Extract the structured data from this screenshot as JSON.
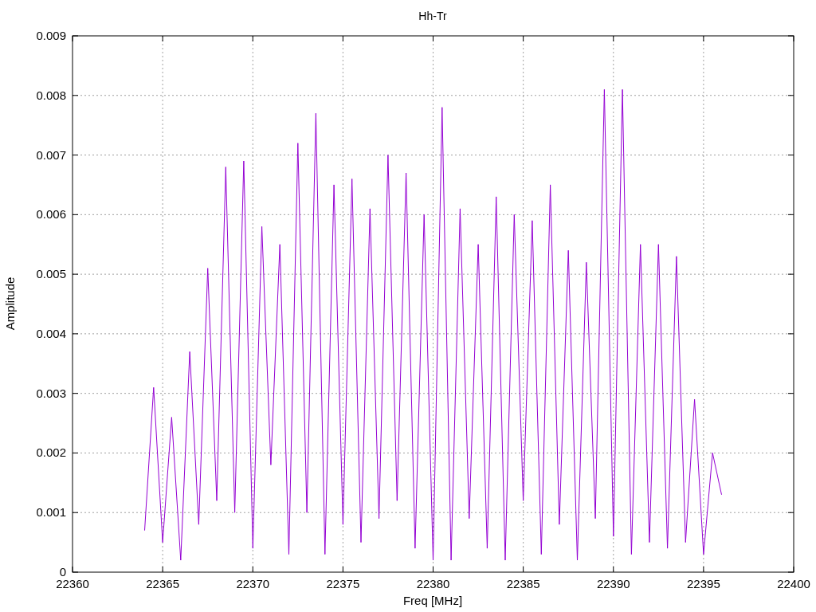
{
  "chart_data": {
    "type": "line",
    "title": "Hh-Tr",
    "xlabel": "Freq [MHz]",
    "ylabel": "Amplitude",
    "grid": true,
    "xlim": [
      22360,
      22400
    ],
    "ylim": [
      0,
      0.009
    ],
    "xticks": [
      22360,
      22365,
      22370,
      22375,
      22380,
      22385,
      22390,
      22395,
      22400
    ],
    "yticks": [
      {
        "value": 0,
        "label": "0"
      },
      {
        "value": 0.001,
        "label": "0.001"
      },
      {
        "value": 0.002,
        "label": "0.002"
      },
      {
        "value": 0.003,
        "label": "0.003"
      },
      {
        "value": 0.004,
        "label": "0.004"
      },
      {
        "value": 0.005,
        "label": "0.005"
      },
      {
        "value": 0.006,
        "label": "0.006"
      },
      {
        "value": 0.007,
        "label": "0.007"
      },
      {
        "value": 0.008,
        "label": "0.008"
      },
      {
        "value": 0.009,
        "label": "0.009"
      }
    ],
    "x": [
      22364,
      22364.5,
      22365,
      22365.5,
      22366,
      22366.5,
      22367,
      22367.5,
      22368,
      22368.5,
      22369,
      22369.5,
      22370,
      22370.5,
      22371,
      22371.5,
      22372,
      22372.5,
      22373,
      22373.5,
      22374,
      22374.5,
      22375,
      22375.5,
      22376,
      22376.5,
      22377,
      22377.5,
      22378,
      22378.5,
      22379,
      22379.5,
      22380,
      22380.5,
      22381,
      22381.5,
      22382,
      22382.5,
      22383,
      22383.5,
      22384,
      22384.5,
      22385,
      22385.5,
      22386,
      22386.5,
      22387,
      22387.5,
      22388,
      22388.5,
      22389,
      22389.5,
      22390,
      22390.5,
      22391,
      22391.5,
      22392,
      22392.5,
      22393,
      22393.5,
      22394,
      22394.5,
      22395,
      22395.5,
      22396
    ],
    "series": [
      {
        "color": "#9400d3",
        "values": [
          0.0007,
          0.0031,
          0.0005,
          0.0026,
          0.0002,
          0.0037,
          0.0008,
          0.0051,
          0.0012,
          0.0068,
          0.001,
          0.0069,
          0.0004,
          0.0058,
          0.0018,
          0.0055,
          0.0003,
          0.0072,
          0.001,
          0.0077,
          0.0003,
          0.0065,
          0.0008,
          0.0066,
          0.0005,
          0.0061,
          0.0009,
          0.007,
          0.0012,
          0.0067,
          0.0004,
          0.006,
          0.0002,
          0.0078,
          0.0002,
          0.0061,
          0.0009,
          0.0055,
          0.0004,
          0.0063,
          0.0002,
          0.006,
          0.0012,
          0.0059,
          0.0003,
          0.0065,
          0.0008,
          0.0054,
          0.0002,
          0.0052,
          0.0009,
          0.0081,
          0.0006,
          0.0081,
          0.0003,
          0.0055,
          0.0005,
          0.0055,
          0.0004,
          0.0053,
          0.0005,
          0.0029,
          0.0003,
          0.002,
          0.0013
        ]
      }
    ]
  }
}
